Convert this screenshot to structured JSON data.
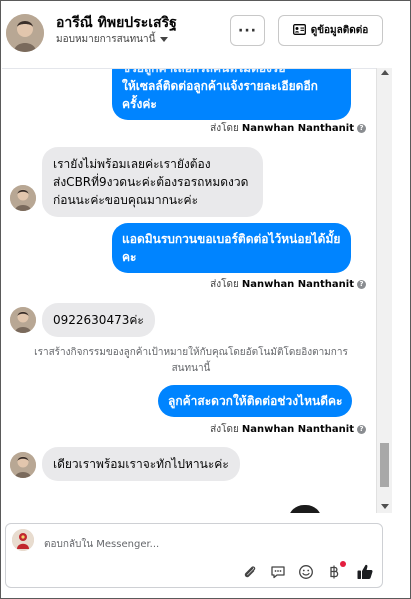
{
  "header": {
    "contact_name": "อารีณี ทิพยประเสริฐ",
    "assigned_to": "มอบหมายการสนทนานี้",
    "more_label": "···",
    "info_label": "ดูข้อมูลติดต่อ"
  },
  "messages": {
    "m1_line1": "ให้เซลล์ติดต่อลูกค้าแจ้งรายละเอียดอีก",
    "m1_line2": "ครั้งค่ะ",
    "m1_partial": "ช่วยลูกค้าเลือกรถคันที่ไม่ต้องรอ",
    "sent_by_prefix": "ส่งโดย",
    "sender": "Nanwhan Nanthanit",
    "m2_line1": "เรายังไม่พร้อมเลยค่ะเรายังต้อง",
    "m2_line2": "ส่งCBRที่9งวดนะค่ะต้องรอรถหมดงวด",
    "m2_line3": "ก่อนนะค่ะขอบคุณมากนะค่ะ",
    "m3_line1": "แอดมินรบกวนขอเบอร์ติดต่อไว้หน่อยได้มั้ย",
    "m3_line2": "คะ",
    "m4": "0922630473ค่ะ",
    "system_line1": "เราสร้างกิจกรรมของลูกค้าเป้าหมายให้กับคุณโดยอัตโนมัติโดยอิงตามการ",
    "system_line2": "สนทนานี้",
    "m5": "ลูกค้าสะดวกให้ติดต่อช่วงไหนดีคะ",
    "m6": "เดียวเราพร้อมเราจะทักไปหานะค่ะ"
  },
  "composer": {
    "placeholder": "ตอบกลับใน Messenger..."
  },
  "colors": {
    "outgoing_bubble": "#0084ff",
    "incoming_bubble": "#e9e9eb",
    "like_icon": "#1c1e21",
    "notification_dot": "#e41e3f"
  }
}
